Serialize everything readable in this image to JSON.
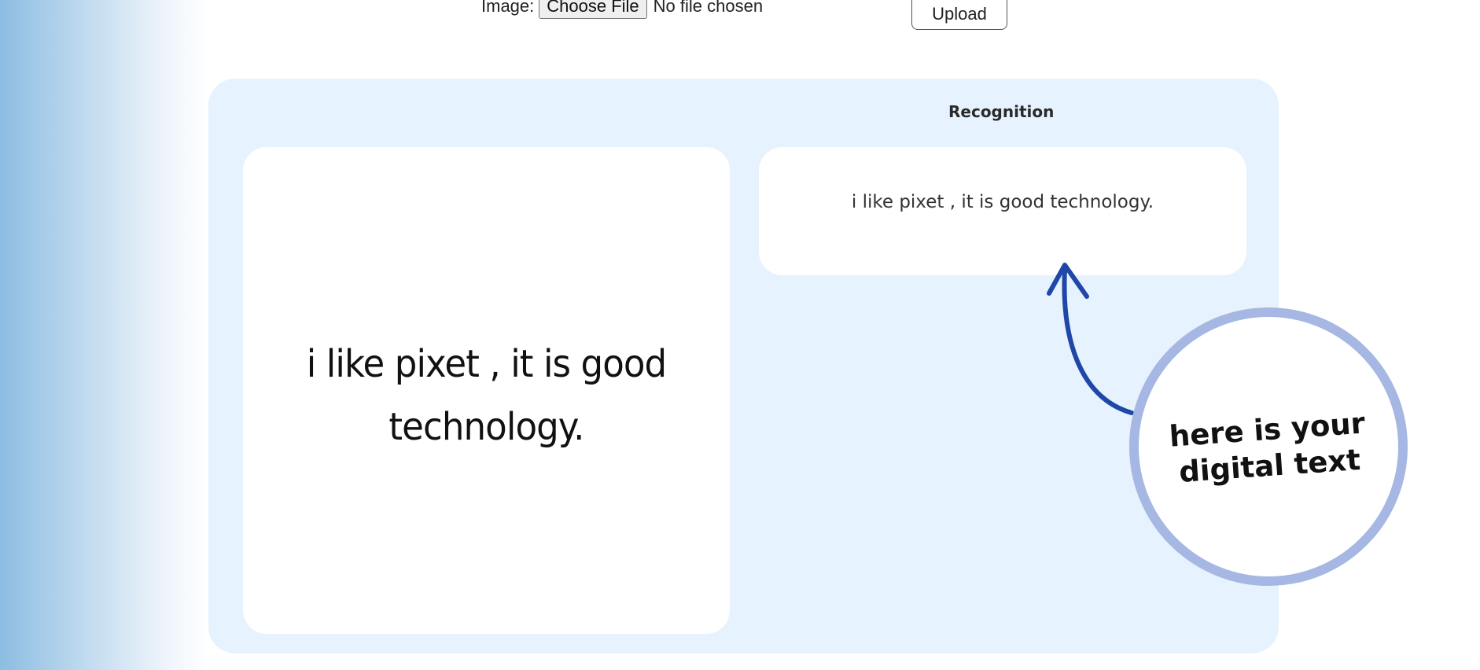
{
  "upload_form": {
    "image_label": "Image:",
    "choose_file_label": "Choose File",
    "file_status": "No file chosen",
    "upload_label": "Upload"
  },
  "panel": {
    "heading": "Recognition",
    "handwriting_line1": "i like pixet , it is good",
    "handwriting_line2": "technology.",
    "recognized_text": "i like pixet , it is good technology.",
    "callout_line1": "here is your",
    "callout_line2": "digital text"
  },
  "colors": {
    "panel_background": "#e6f2fd",
    "arrow": "#1e47a8",
    "callout_ring": "#a5b7e2",
    "left_gradient": "#8cbde2"
  },
  "icons": {
    "arrow": "curved-arrow-icon"
  }
}
